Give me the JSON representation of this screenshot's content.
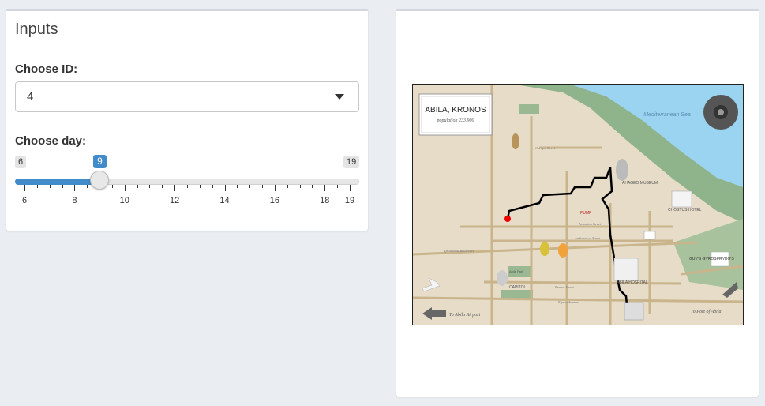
{
  "inputs": {
    "title": "Inputs",
    "id_label": "Choose ID:",
    "id_value": "4",
    "day_label": "Choose day:",
    "day_slider": {
      "min": 6,
      "max": 19,
      "value": 9,
      "min_text": "6",
      "max_text": "19",
      "value_text": "9",
      "tick_labels": [
        "6",
        "8",
        "10",
        "12",
        "14",
        "16",
        "18",
        "19"
      ]
    }
  },
  "map": {
    "title": "ABILA, KRONOS",
    "subtitle": "population 233,900",
    "sea_label": "Mediterranean Sea",
    "airport_label": "To Abila Airport",
    "port_label": "To Port of Abila",
    "streets": [
      "Carnpo Street",
      "Arkadiou Street",
      "Androutsou Street",
      "Ermou Street",
      "Egeou Avenue",
      "Ipsilantou Boulevard",
      "Sgourou Street",
      "Pilau Street"
    ],
    "places": [
      "AHAGEO MUSEUM",
      "CHOSTUS HOTEL",
      "ABILA HOSPITAL",
      "CAPITOL",
      "Abila Park",
      "PUMP",
      "GUY'S GYROS",
      "FRYDO'S"
    ],
    "colors": {
      "land": "#e6dcc8",
      "sea": "#9bd4f0",
      "park": "#8fb38a",
      "road": "#c9b48c",
      "route": "#000000"
    }
  }
}
